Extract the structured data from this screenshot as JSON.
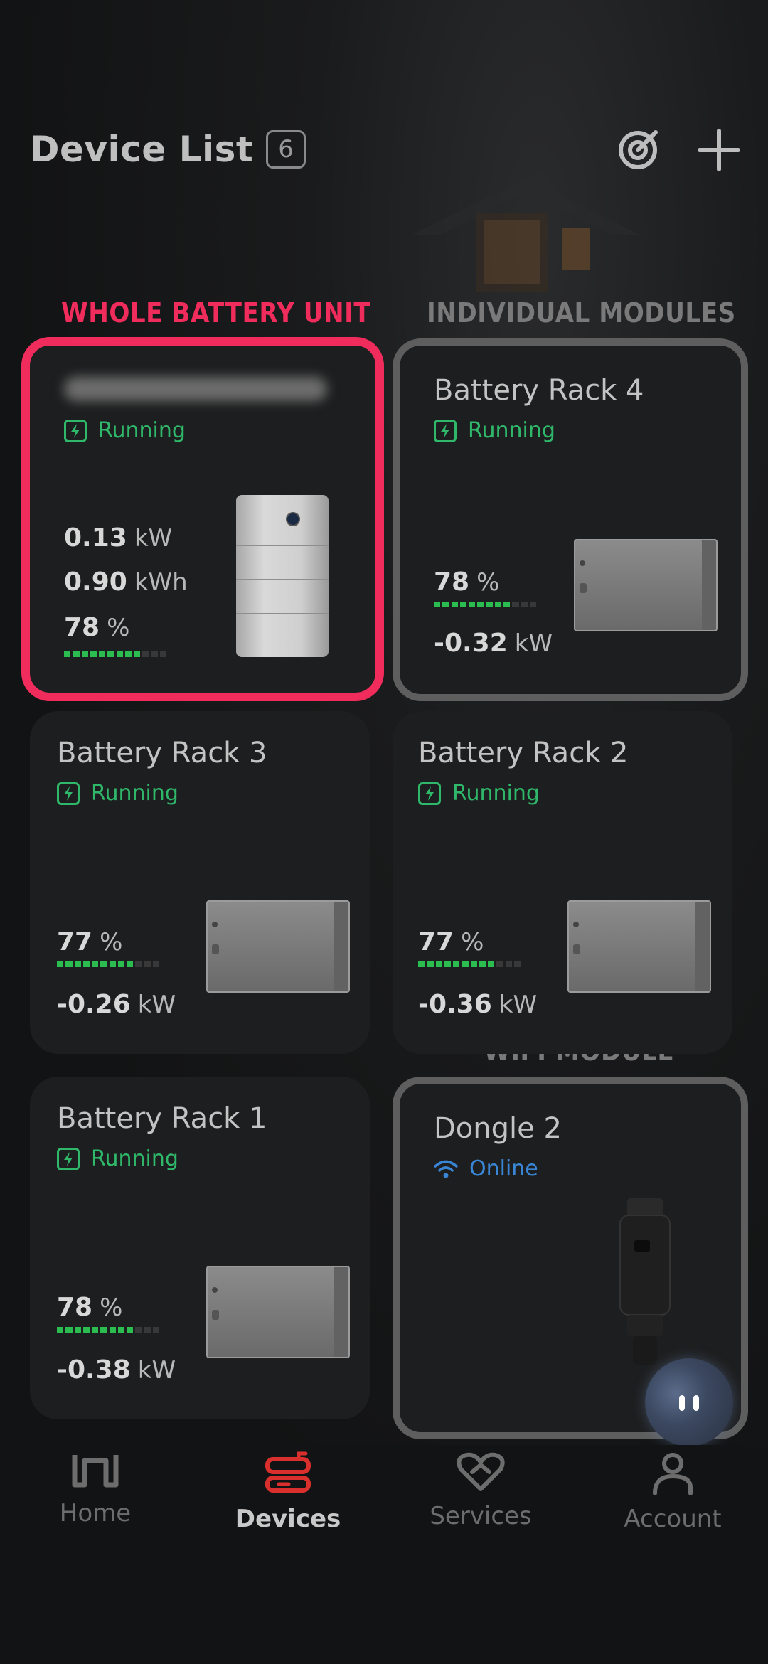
{
  "header": {
    "title": "Device List",
    "count": "6"
  },
  "labels": {
    "whole": "WHOLE BATTERY UNIT",
    "individual": "INDIVIDUAL MODULES",
    "wifi": "WIFI MODULE"
  },
  "colors": {
    "accent_red": "#ef2c5b",
    "running_green": "#2fb86a",
    "online_blue": "#3a86d6",
    "bar_green": "#2bbd4f"
  },
  "cards": {
    "main": {
      "status": "Running",
      "power": "0.13",
      "power_unit": "kW",
      "energy": "0.90",
      "energy_unit": "kWh",
      "soc": "78",
      "soc_unit": "%",
      "soc_fraction": 0.78
    },
    "rack4": {
      "name": "Battery Rack 4",
      "status": "Running",
      "soc": "78",
      "soc_unit": "%",
      "soc_fraction": 0.78,
      "power": "-0.32",
      "power_unit": "kW"
    },
    "rack3": {
      "name": "Battery Rack 3",
      "status": "Running",
      "soc": "77",
      "soc_unit": "%",
      "soc_fraction": 0.77,
      "power": "-0.26",
      "power_unit": "kW"
    },
    "rack2": {
      "name": "Battery Rack 2",
      "status": "Running",
      "soc": "77",
      "soc_unit": "%",
      "soc_fraction": 0.77,
      "power": "-0.36",
      "power_unit": "kW"
    },
    "rack1": {
      "name": "Battery Rack 1",
      "status": "Running",
      "soc": "78",
      "soc_unit": "%",
      "soc_fraction": 0.78,
      "power": "-0.38",
      "power_unit": "kW"
    },
    "dongle": {
      "name": "Dongle 2",
      "status": "Online"
    }
  },
  "tabs": {
    "home": "Home",
    "devices": "Devices",
    "services": "Services",
    "account": "Account"
  },
  "icons": {
    "scan": "scan-target-icon",
    "add": "plus-icon",
    "running": "bolt-icon",
    "online": "wifi-icon"
  }
}
